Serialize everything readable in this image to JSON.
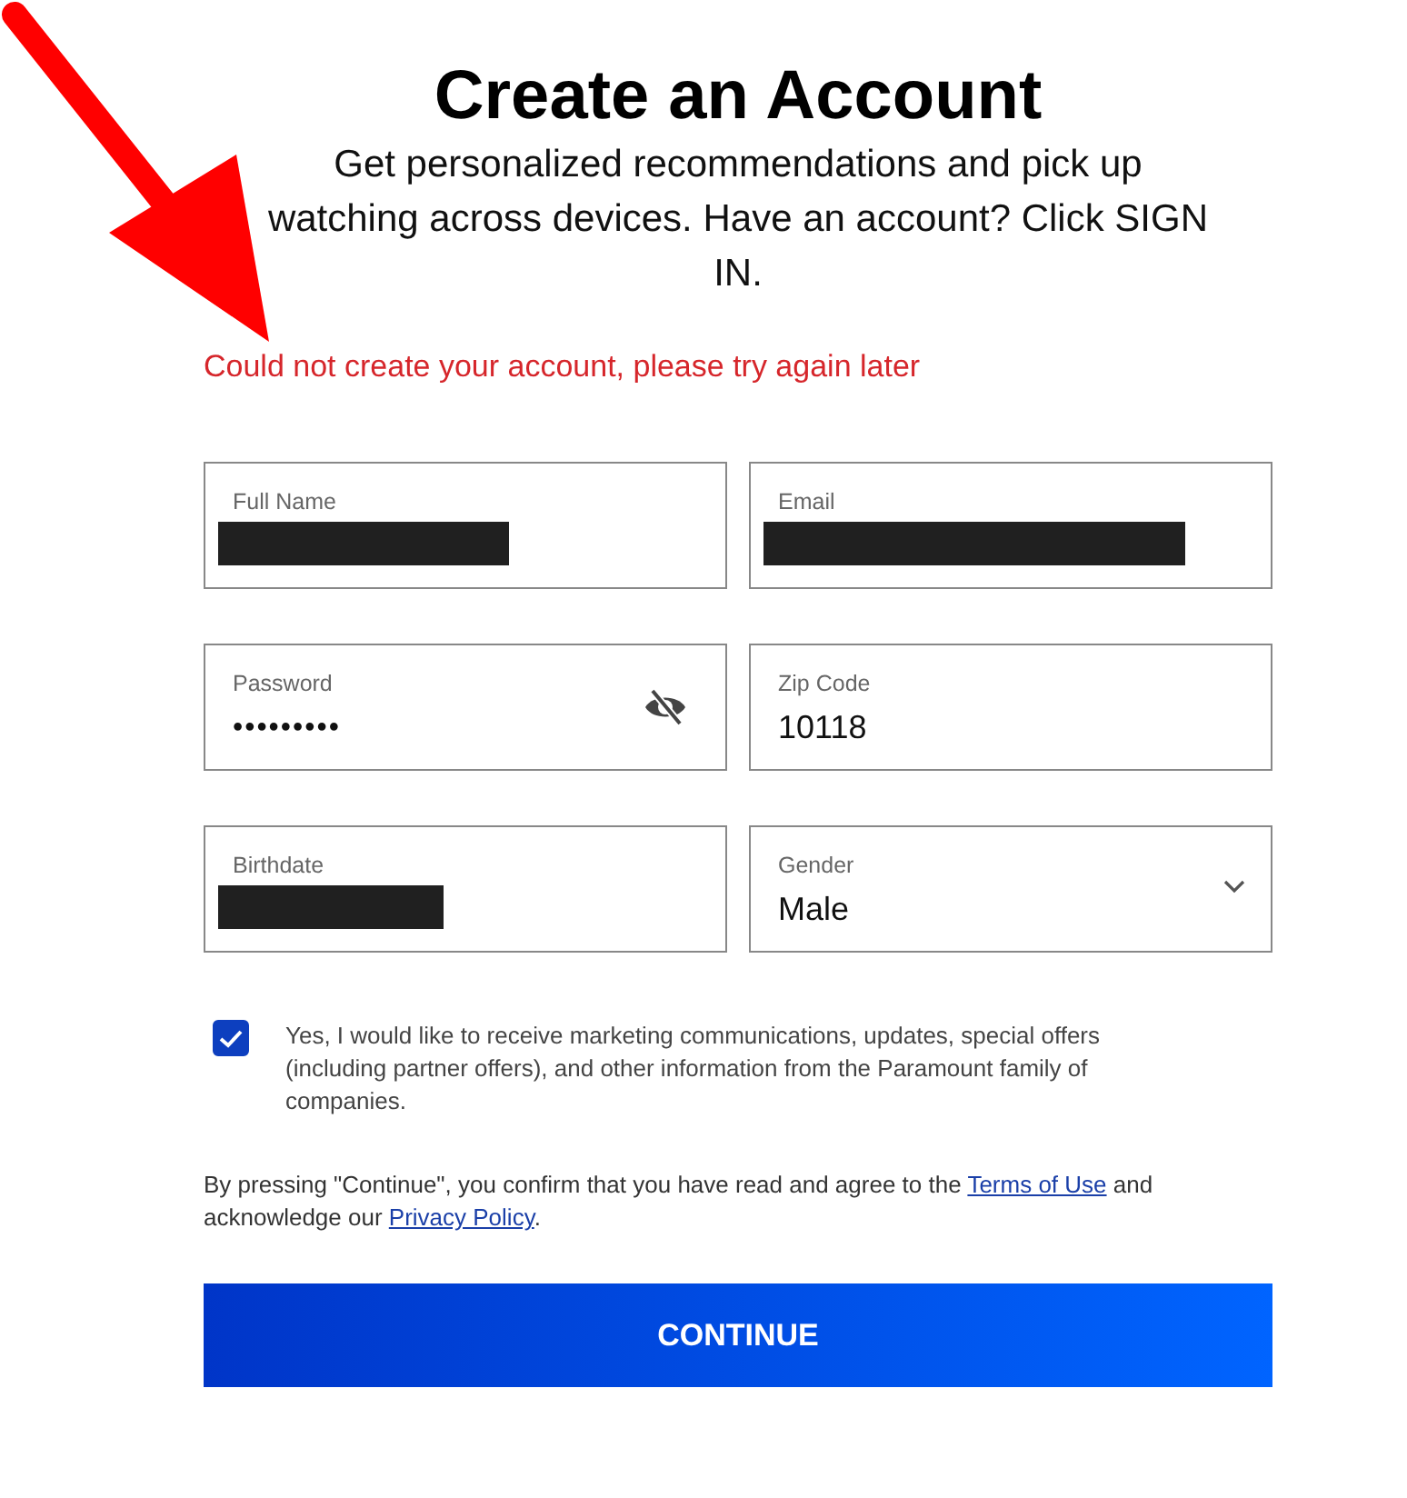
{
  "title": "Create an Account",
  "subtitle": "Get personalized recommendations and pick up watching across devices. Have an account? Click SIGN IN.",
  "error": "Could not create your account, please try again later",
  "fields": [
    {
      "kind": "text",
      "label": "Full Name",
      "redacted": true
    },
    {
      "kind": "text",
      "label": "Email",
      "redacted": true
    },
    {
      "kind": "password",
      "label": "Password",
      "value": "•••••••••"
    },
    {
      "kind": "text",
      "label": "Zip Code",
      "value": "10118"
    },
    {
      "kind": "text",
      "label": "Birthdate",
      "redacted": true
    },
    {
      "kind": "select",
      "label": "Gender",
      "value": "Male"
    }
  ],
  "marketing": {
    "checked": true,
    "label": "Yes, I would like to receive marketing communications, updates, special offers (including partner offers), and other information from the Paramount family of companies."
  },
  "legal": [
    {
      "kind": "text",
      "text": "By pressing \"Continue\", you confirm that you have read and agree to the "
    },
    {
      "kind": "link",
      "text": "Terms of Use"
    },
    {
      "kind": "text",
      "text": " and acknowledge our "
    },
    {
      "kind": "link",
      "text": "Privacy Policy"
    },
    {
      "kind": "text",
      "text": "."
    }
  ],
  "button": "CONTINUE"
}
